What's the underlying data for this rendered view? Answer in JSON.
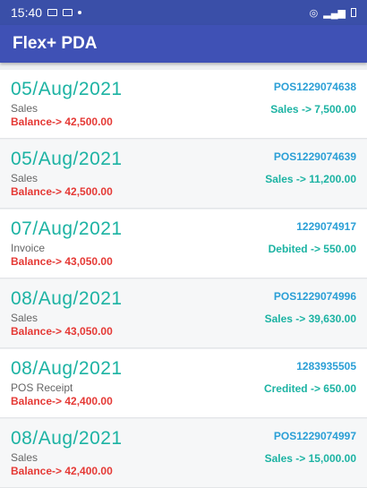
{
  "status_bar": {
    "time": "15:40"
  },
  "app": {
    "title": "Flex+ PDA"
  },
  "transactions": [
    {
      "date": "05/Aug/2021",
      "type": "Sales",
      "balance": "Balance-> 42,500.00",
      "ref": "POS1229074638",
      "amount": "Sales -> 7,500.00"
    },
    {
      "date": "05/Aug/2021",
      "type": "Sales",
      "balance": "Balance-> 42,500.00",
      "ref": "POS1229074639",
      "amount": "Sales -> 11,200.00"
    },
    {
      "date": "07/Aug/2021",
      "type": "Invoice",
      "balance": "Balance-> 43,050.00",
      "ref": "1229074917",
      "amount": "Debited -> 550.00"
    },
    {
      "date": "08/Aug/2021",
      "type": "Sales",
      "balance": "Balance-> 43,050.00",
      "ref": "POS1229074996",
      "amount": "Sales -> 39,630.00"
    },
    {
      "date": "08/Aug/2021",
      "type": "POS Receipt",
      "balance": "Balance-> 42,400.00",
      "ref": "1283935505",
      "amount": "Credited -> 650.00"
    },
    {
      "date": "08/Aug/2021",
      "type": "Sales",
      "balance": "Balance-> 42,400.00",
      "ref": "POS1229074997",
      "amount": "Sales -> 15,000.00"
    }
  ]
}
